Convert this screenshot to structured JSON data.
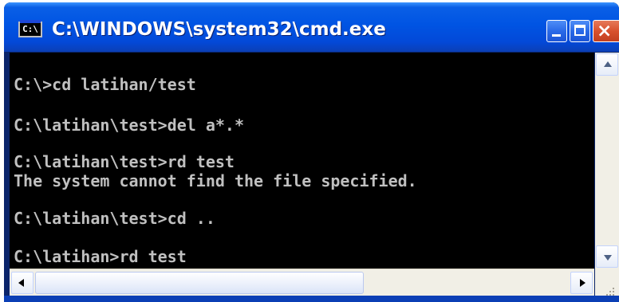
{
  "window": {
    "title": "C:\\WINDOWS\\system32\\cmd.exe",
    "icon": "cmd-icon",
    "icon_text": "C:\\"
  },
  "caption_buttons": {
    "minimize": "minimize-icon",
    "maximize": "maximize-icon",
    "close": "close-icon",
    "close_glyph": "×"
  },
  "console": {
    "background": "#000000",
    "foreground": "#c0c0c0",
    "lines": [
      "C:\\>cd latihan/test",
      "C:\\latihan\\test>del a*.*",
      "C:\\latihan\\test>rd test",
      "The system cannot find the file specified.",
      "C:\\latihan\\test>cd ..",
      "C:\\latihan>rd test"
    ]
  },
  "scrollbars": {
    "vertical": {
      "up": "arrow-up-icon",
      "down": "arrow-down-icon"
    },
    "horizontal": {
      "left": "arrow-left-icon",
      "right": "arrow-right-icon"
    }
  },
  "colors": {
    "titlebar": "#0054e3",
    "close_button": "#d8512e",
    "scrollbar_track": "#f1efe6"
  }
}
